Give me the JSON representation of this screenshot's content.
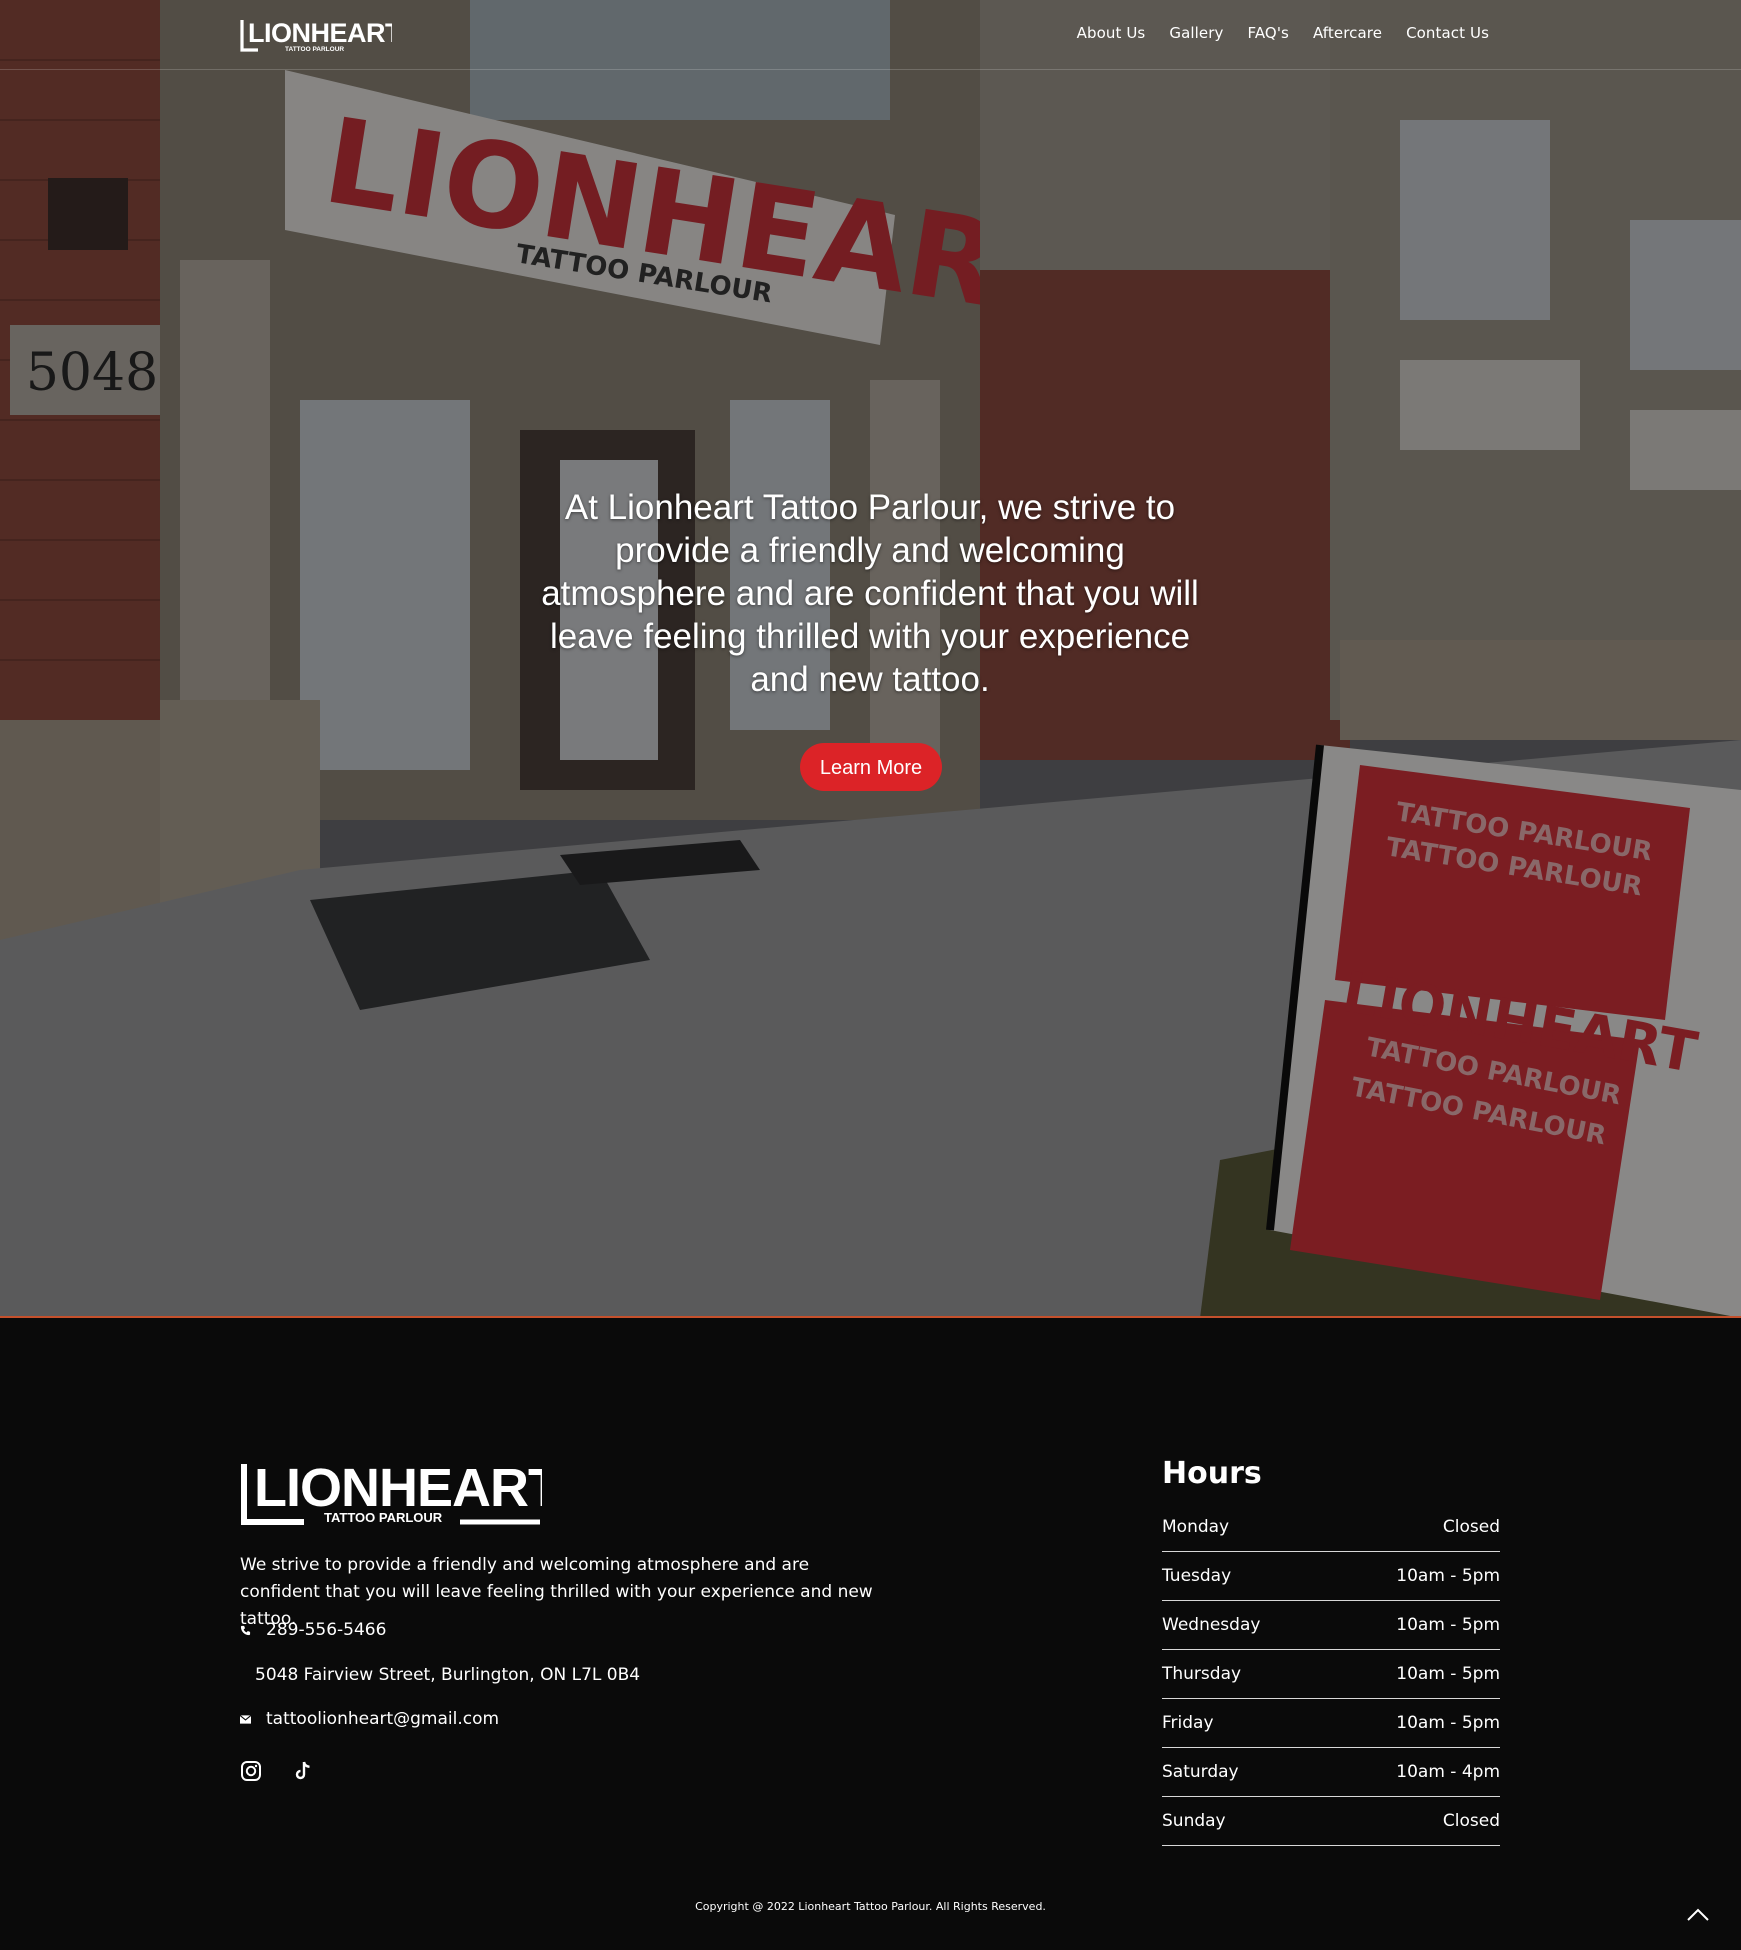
{
  "brand": {
    "logo_text": "LIONHEART",
    "logo_sub": "TATTOO PARLOUR"
  },
  "nav": {
    "items": [
      {
        "label": "About Us"
      },
      {
        "label": "Gallery"
      },
      {
        "label": "FAQ's"
      },
      {
        "label": "Aftercare"
      },
      {
        "label": "Contact Us"
      }
    ]
  },
  "hero": {
    "storefront_sign": "LIONHEART",
    "storefront_sign_sub": "TATTOO PARLOUR",
    "street_number": "5048",
    "sandwich_board_text": "TATTOO PARLOUR",
    "headline": "At Lionheart Tattoo Parlour, we strive to provide a friendly and welcoming atmosphere and are confident that you will leave feeling thrilled with your experience and new tattoo.",
    "button_label": "Learn More",
    "accent_color": "#dc2327"
  },
  "footer": {
    "description": "We strive to provide a friendly and welcoming atmosphere and are confident that you will leave feeling thrilled with your experience and new tattoo.",
    "phone": "289-556-5466",
    "address": "5048 Fairview Street, Burlington, ON L7L 0B4",
    "email": "tattoolionheart@gmail.com",
    "social": [
      {
        "icon": "instagram-icon"
      },
      {
        "icon": "tiktok-icon"
      }
    ],
    "hours_title": "Hours",
    "hours": [
      {
        "day": "Monday",
        "time": "Closed"
      },
      {
        "day": "Tuesday",
        "time": "10am - 5pm"
      },
      {
        "day": "Wednesday",
        "time": "10am - 5pm"
      },
      {
        "day": "Thursday",
        "time": "10am - 5pm"
      },
      {
        "day": "Friday",
        "time": "10am - 5pm"
      },
      {
        "day": "Saturday",
        "time": "10am - 4pm"
      },
      {
        "day": "Sunday",
        "time": "Closed"
      }
    ],
    "copyright": "Copyright @ 2022 Lionheart Tattoo Parlour. All Rights Reserved.",
    "back_to_top_icon": "chevron-up-icon"
  }
}
